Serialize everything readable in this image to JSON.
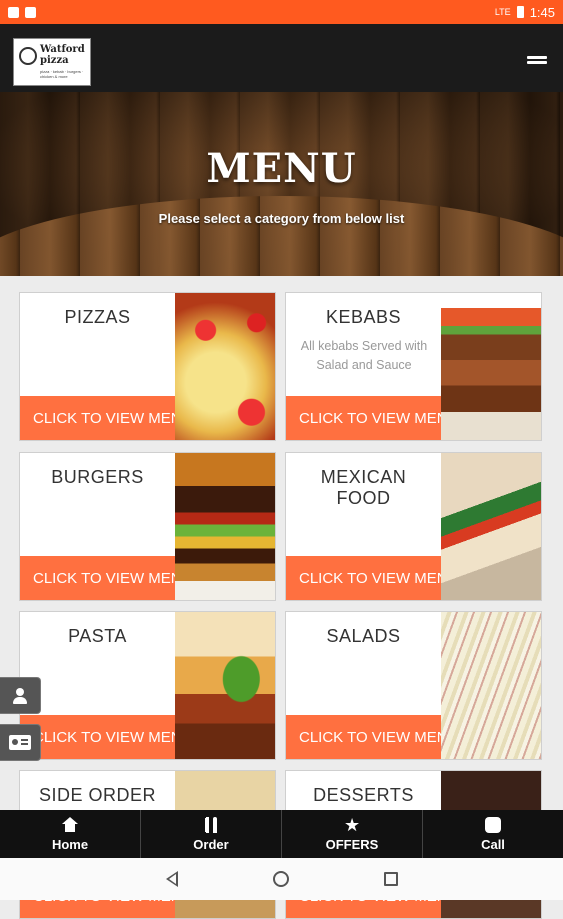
{
  "status_bar": {
    "time": "1:45",
    "signal": "LTE"
  },
  "logo": {
    "text": "Watford\npizza",
    "sub": "pizza · kebab · burgers · chicken & more"
  },
  "hero": {
    "title": "MENU",
    "subtitle": "Please select a category from below list"
  },
  "categories": [
    {
      "title": "PIZZAS",
      "description": "",
      "cta": "CLICK TO VIEW MENU",
      "image": "pizza-image"
    },
    {
      "title": "KEBABS",
      "description": "All kebabs Served with Salad and Sauce",
      "cta": "CLICK TO VIEW MENU",
      "image": "kebab-image"
    },
    {
      "title": "BURGERS",
      "description": "",
      "cta": "CLICK TO VIEW MENU",
      "image": "burger-image"
    },
    {
      "title": "MEXICAN FOOD",
      "description": "",
      "cta": "CLICK TO VIEW MENU",
      "image": "wrap-image"
    },
    {
      "title": "PASTA",
      "description": "",
      "cta": "CLICK TO VIEW MENU",
      "image": "pasta-image"
    },
    {
      "title": "SALADS",
      "description": "",
      "cta": "CLICK TO VIEW MENU",
      "image": "salad-image"
    },
    {
      "title": "SIDE ORDER",
      "description": "",
      "cta": "CLICK TO VIEW MENU",
      "image": "side-image"
    },
    {
      "title": "DESSERTS",
      "description": "",
      "cta": "CLICK TO VIEW MENU",
      "image": "dessert-image"
    }
  ],
  "bottom_nav": [
    {
      "label": "Home",
      "icon": "home-icon"
    },
    {
      "label": "Order",
      "icon": "cutlery-icon"
    },
    {
      "label": "OFFERS",
      "icon": "star-icon"
    },
    {
      "label": "Call",
      "icon": "phone-icon"
    }
  ],
  "colors": {
    "status_bar": "#ff5a1f",
    "cta": "#ff7040",
    "header": "#1b1b1b"
  }
}
